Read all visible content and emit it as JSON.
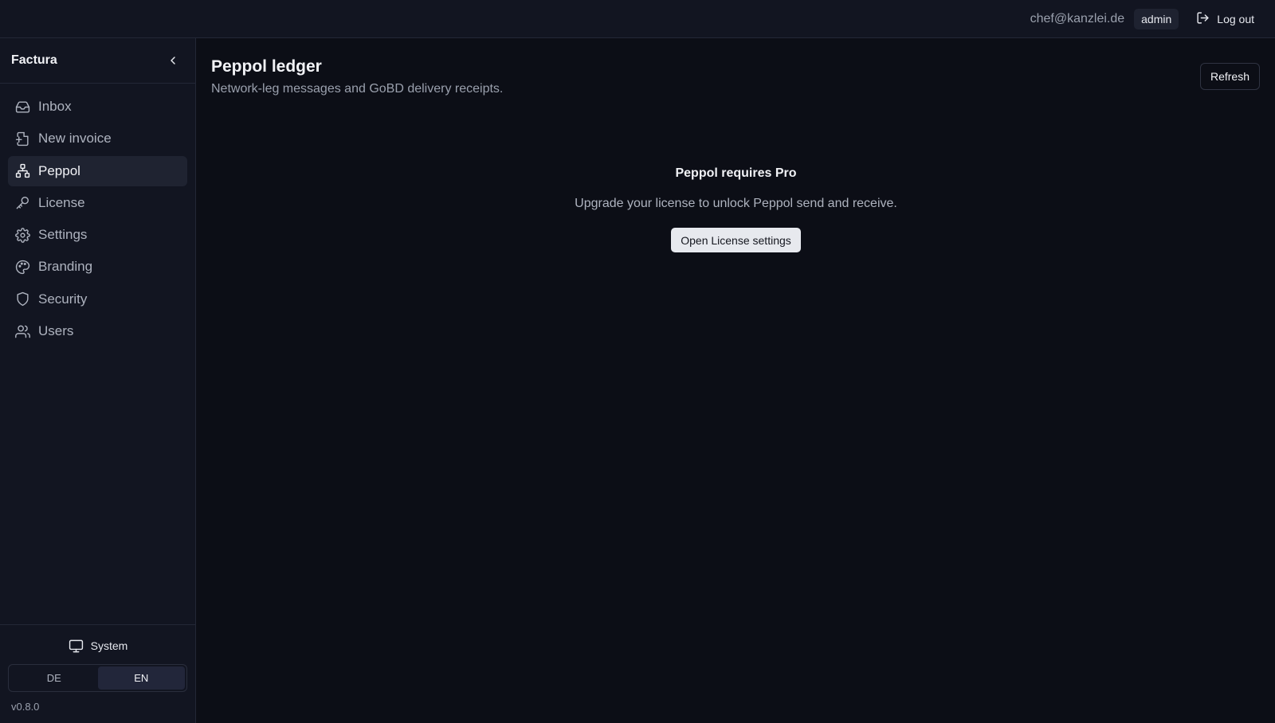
{
  "header": {
    "user_email": "chef@kanzlei.de",
    "role": "admin",
    "logout_label": "Log out"
  },
  "sidebar": {
    "brand": "Factura",
    "items": [
      {
        "label": "Inbox",
        "icon": "inbox-icon"
      },
      {
        "label": "New invoice",
        "icon": "file-plus-icon"
      },
      {
        "label": "Peppol",
        "icon": "network-icon",
        "active": true
      },
      {
        "label": "License",
        "icon": "key-icon"
      },
      {
        "label": "Settings",
        "icon": "gear-icon"
      },
      {
        "label": "Branding",
        "icon": "palette-icon"
      },
      {
        "label": "Security",
        "icon": "shield-icon"
      },
      {
        "label": "Users",
        "icon": "users-icon"
      }
    ],
    "theme_label": "System",
    "languages": [
      "DE",
      "EN"
    ],
    "active_language": "EN",
    "version": "v0.8.0"
  },
  "main": {
    "title": "Peppol ledger",
    "subtitle": "Network-leg messages and GoBD delivery receipts.",
    "refresh_label": "Refresh",
    "empty_state": {
      "title": "Peppol requires Pro",
      "text": "Upgrade your license to unlock Peppol send and receive.",
      "button_label": "Open License settings"
    }
  },
  "colors": {
    "background": "#0c0e16",
    "panel": "#121521",
    "border": "#232736",
    "active_item": "#1f2331",
    "primary_button": "#e7e9ee"
  }
}
